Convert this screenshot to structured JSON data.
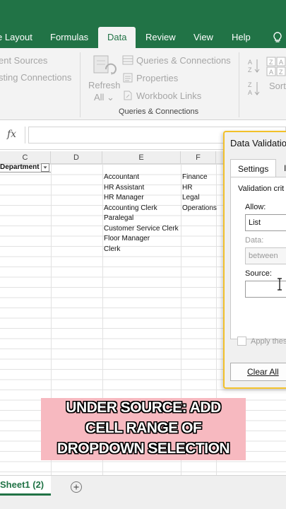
{
  "ribbon_tabs": [
    {
      "label": "e Layout"
    },
    {
      "label": "Formulas"
    },
    {
      "label": "Data",
      "active": true
    },
    {
      "label": "Review"
    },
    {
      "label": "View"
    },
    {
      "label": "Help"
    }
  ],
  "ribbon": {
    "get_data_items": [
      "ent Sources",
      "sting Connections"
    ],
    "refresh_all": {
      "line1": "Refresh",
      "line2": "All ⌄"
    },
    "queries_group": {
      "items": [
        "Queries & Connections",
        "Properties",
        "Workbook Links"
      ],
      "label": "Queries & Connections"
    },
    "sort_label": "Sort"
  },
  "formula_bar": {
    "fx": "fx",
    "value": ""
  },
  "columns": [
    "C",
    "D",
    "E",
    "F"
  ],
  "sheet": {
    "c_header": "Department",
    "e_values": [
      "Accountant",
      "HR Assistant",
      "HR Manager",
      "Accounting Clerk",
      "Paralegal",
      "Customer Service Clerk",
      "Floor Manager",
      "Clerk"
    ],
    "f_values": [
      "Finance",
      "HR",
      "Legal",
      "Operations"
    ]
  },
  "dialog": {
    "title": "Data Validatio",
    "tabs": [
      "Settings",
      "In"
    ],
    "criteria_label": "Validation crit",
    "allow_label": "Allow:",
    "allow_value": "List",
    "data_label": "Data:",
    "data_value": "between",
    "source_label": "Source:",
    "source_value": "",
    "apply_label": "Apply thes",
    "clear_all_label": "Clear All"
  },
  "caption": {
    "lines": [
      "UNDER SOURCE: ADD",
      "CELL RANGE OF",
      "DROPDOWN SELECTION"
    ]
  },
  "sheet_tabs": {
    "active": "Sheet1 (2)"
  },
  "colors": {
    "excel_green": "#217346",
    "caption_bg": "#f7b9c0",
    "dialog_border": "#f2c029"
  }
}
